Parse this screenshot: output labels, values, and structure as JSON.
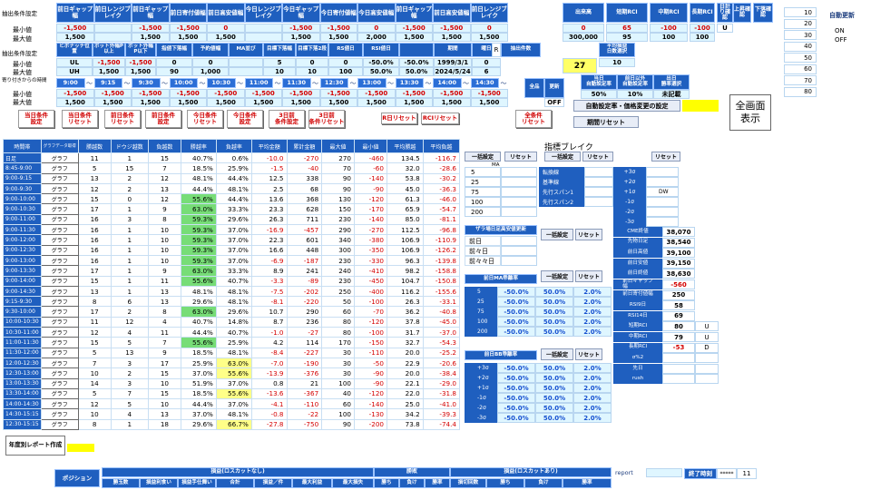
{
  "top": {
    "row1_label": "抽出条件設定",
    "row1_headers": [
      "前日ギャップ幅",
      "前日レンジブレイク",
      "前日ギャップ幅",
      "前日寄付値幅",
      "前日高安値幅",
      "今日レンジブレイク",
      "今日ギャップ幅",
      "今日寄付値幅",
      "今日高安値幅",
      "前日ギャップ幅",
      "前日高安値幅",
      "前日レンジブレイク"
    ],
    "min_label": "最小値",
    "max_label": "最大値",
    "row1_min": [
      "-1,500",
      "",
      "-1,500",
      "-1,500",
      "0",
      "",
      "-1,500",
      "-1,500",
      "0",
      "-1,500",
      "-1,500",
      "0"
    ],
    "row1_max": [
      "1,500",
      "",
      "1,500",
      "1,500",
      "1,500",
      "",
      "1,500",
      "1,500",
      "2,000",
      "1,500",
      "1,500",
      "1,500"
    ],
    "right1_headers": [
      "出来高",
      "短期RCI",
      "中期RCI",
      "長期RCI",
      "日計り確認",
      "上昇確認",
      "下落確認"
    ],
    "right1_min": [
      "0",
      "65",
      "-100",
      "-100"
    ],
    "right1_max": [
      "300,000",
      "95",
      "100",
      "100"
    ],
    "right1_u": "U",
    "side_col": [
      "10",
      "20",
      "30",
      "40",
      "50",
      "60",
      "70",
      "80"
    ],
    "auto_update_label": "自動更新",
    "on_label": "ON",
    "off_label": "OFF",
    "row2_label": "抽出条件設定",
    "row2_headers": [
      "ヒボナッチ位置",
      "ボット外幅P以上",
      "ボット外幅P以下",
      "指値下落幅",
      "予約値幅",
      "MA並び",
      "目標下落幅",
      "目標下落2段",
      "RS値日",
      "RSI値日",
      "",
      "期間",
      "曜日",
      "抽出件数"
    ],
    "row2_min": [
      "UL",
      "-1,500",
      "-1,500",
      "0",
      "0",
      "",
      "5",
      "0",
      "0",
      "-50.0%",
      "-50.0%",
      "1999/3/1",
      "0"
    ],
    "row2_max": [
      "UH",
      "1,500",
      "1,500",
      "90",
      "1,000",
      "",
      "10",
      "10",
      "100",
      "50.0%",
      "50.0%",
      "2024/5/24",
      "6"
    ],
    "row2_R": "R",
    "count_value": "27",
    "avg_label": "平均損益\n日数選択",
    "avg_value": "10",
    "row3_label": "寄り付きからの時間",
    "row3_values": [
      "9:00",
      "9:15",
      "9:30",
      "10:00",
      "10:30",
      "11:00",
      "11:30",
      "12:30",
      "13:00",
      "13:30",
      "14:00",
      "14:30"
    ],
    "row3_sep": "〜",
    "row4_min": [
      "-1,500",
      "-1,500",
      "-1,500",
      "-1,500",
      "-1,500",
      "-1,500",
      "-1,500",
      "-1,500",
      "-1,500",
      "-1,500",
      "-1,500",
      "-1,500"
    ],
    "row4_max": [
      "1,500",
      "1,500",
      "1,500",
      "1,500",
      "1,500",
      "1,500",
      "1,500",
      "1,500",
      "1,500",
      "1,500",
      "1,500",
      "1,500"
    ],
    "ud_labels": [
      "全品",
      "更新"
    ],
    "off_value": "OFF",
    "day_labels": [
      "当日\n自動設定率",
      "前日以外\n自動設定率",
      "出日\n勝率選択"
    ],
    "pct_vals": [
      "50%",
      "10%",
      "未記載"
    ]
  },
  "buttons": {
    "reset_row": [
      "当日条件\n設定",
      "当日条件\nリセット",
      "前日条件\nリセット",
      "前日条件\n設定",
      "今日条件\nリセット",
      "今日条件\n設定",
      "3日前\n条件設定",
      "3日前\n条件リセット"
    ],
    "r_reset": "R日リセット",
    "rci_reset": "RCIリセット",
    "all_reset": "全条件\nリセット",
    "auto_setting": "自動設定率・価格変更の設定",
    "period_reset": "期間リセット",
    "fullscreen": "全画面\n表示",
    "yearly_report": "年度別レポート作成"
  },
  "table": {
    "headers": [
      "時間帯",
      "グラフデータ取得",
      "勝越数",
      "ドウジ越数",
      "負越数",
      "勝越率",
      "負越率",
      "平均金額",
      "累計金額",
      "最大値",
      "最小値",
      "平均勝越",
      "平均負越"
    ],
    "graph_label": "グラフ",
    "rows": [
      [
        "日足",
        "11",
        "1",
        "15",
        "40.7%",
        "0.6%",
        "-10.0",
        "-270",
        "270",
        "-460",
        "134.5",
        "-116.7"
      ],
      [
        "8:45-9:00",
        "5",
        "15",
        "7",
        "18.5%",
        "25.9%",
        "-1.5",
        "-40",
        "70",
        "-60",
        "32.0",
        "-28.6"
      ],
      [
        "9:00-9:15",
        "13",
        "2",
        "12",
        "48.1%",
        "44.4%",
        "12.5",
        "338",
        "90",
        "-140",
        "53.8",
        "-30.2"
      ],
      [
        "9:00-9:30",
        "12",
        "2",
        "13",
        "44.4%",
        "48.1%",
        "2.5",
        "68",
        "90",
        "-90",
        "45.0",
        "-36.3"
      ],
      [
        "9:00-10:00",
        "15",
        "0",
        "12",
        "55.6%",
        "44.4%",
        "13.6",
        "368",
        "130",
        "-120",
        "61.3",
        "-46.0"
      ],
      [
        "9:00-10:30",
        "17",
        "1",
        "9",
        "63.0%",
        "33.3%",
        "23.3",
        "628",
        "150",
        "-170",
        "65.9",
        "-54.7"
      ],
      [
        "9:00-11:00",
        "16",
        "3",
        "8",
        "59.3%",
        "29.6%",
        "26.3",
        "711",
        "230",
        "-140",
        "85.0",
        "-81.1"
      ],
      [
        "9:00-11:30",
        "16",
        "1",
        "10",
        "59.3%",
        "37.0%",
        "-16.9",
        "-457",
        "290",
        "-270",
        "112.5",
        "-96.8"
      ],
      [
        "9:00-12:00",
        "16",
        "1",
        "10",
        "59.3%",
        "37.0%",
        "22.3",
        "601",
        "340",
        "-380",
        "106.9",
        "-110.9"
      ],
      [
        "9:00-12:30",
        "16",
        "1",
        "10",
        "59.3%",
        "37.0%",
        "16.6",
        "448",
        "300",
        "-350",
        "106.9",
        "-126.2"
      ],
      [
        "9:00-13:00",
        "16",
        "1",
        "10",
        "59.3%",
        "37.0%",
        "-6.9",
        "-187",
        "230",
        "-330",
        "96.3",
        "-139.8"
      ],
      [
        "9:00-13:30",
        "17",
        "1",
        "9",
        "63.0%",
        "33.3%",
        "8.9",
        "241",
        "240",
        "-410",
        "98.2",
        "-158.8"
      ],
      [
        "9:00-14:00",
        "15",
        "1",
        "11",
        "55.6%",
        "40.7%",
        "-3.3",
        "-89",
        "230",
        "-450",
        "104.7",
        "-150.8"
      ],
      [
        "9:00-14:30",
        "13",
        "1",
        "13",
        "48.1%",
        "48.1%",
        "-7.5",
        "-202",
        "250",
        "-400",
        "116.2",
        "-155.6"
      ],
      [
        "9:15-9:30",
        "8",
        "6",
        "13",
        "29.6%",
        "48.1%",
        "-8.1",
        "-220",
        "50",
        "-100",
        "26.3",
        "-33.1"
      ],
      [
        "9:30-10:00",
        "17",
        "2",
        "8",
        "63.0%",
        "29.6%",
        "10.7",
        "290",
        "60",
        "-70",
        "36.2",
        "-40.8"
      ],
      [
        "10:00-10:30",
        "11",
        "12",
        "4",
        "40.7%",
        "14.8%",
        "8.7",
        "236",
        "80",
        "-120",
        "37.8",
        "-45.0"
      ],
      [
        "10:30-11:00",
        "12",
        "4",
        "11",
        "44.4%",
        "40.7%",
        "-1.0",
        "-27",
        "80",
        "-100",
        "31.7",
        "-37.0"
      ],
      [
        "11:00-11:30",
        "15",
        "5",
        "7",
        "55.6%",
        "25.9%",
        "4.2",
        "114",
        "170",
        "-150",
        "32.7",
        "-54.3"
      ],
      [
        "11:30-12:00",
        "5",
        "13",
        "9",
        "18.5%",
        "48.1%",
        "-8.4",
        "-227",
        "30",
        "-110",
        "20.0",
        "-25.2"
      ],
      [
        "12:00-12:30",
        "7",
        "3",
        "17",
        "25.9%",
        "63.0%",
        "-7.0",
        "-190",
        "30",
        "-50",
        "22.9",
        "-20.6"
      ],
      [
        "12:30-13:00",
        "10",
        "2",
        "15",
        "37.0%",
        "55.6%",
        "-13.9",
        "-376",
        "30",
        "-90",
        "20.0",
        "-38.4"
      ],
      [
        "13:00-13:30",
        "14",
        "3",
        "10",
        "51.9%",
        "37.0%",
        "0.8",
        "21",
        "100",
        "-90",
        "22.1",
        "-29.0"
      ],
      [
        "13:30-14:00",
        "5",
        "7",
        "15",
        "18.5%",
        "55.6%",
        "-13.6",
        "-367",
        "40",
        "-120",
        "22.0",
        "-31.8"
      ],
      [
        "14:00-14:30",
        "12",
        "5",
        "10",
        "44.4%",
        "37.0%",
        "-4.1",
        "-110",
        "60",
        "-140",
        "25.0",
        "-41.0"
      ],
      [
        "14:30-15:15",
        "10",
        "4",
        "13",
        "37.0%",
        "48.1%",
        "-0.8",
        "-22",
        "100",
        "-130",
        "34.2",
        "-39.3"
      ],
      [
        "12:30-15:15",
        "8",
        "1",
        "18",
        "29.6%",
        "66.7%",
        "-27.8",
        "-750",
        "90",
        "-200",
        "73.8",
        "-74.4"
      ]
    ]
  },
  "break": {
    "title": "指標ブレイク",
    "ma_label": "MA",
    "hi_label": "日",
    "ma_btns": [
      "一括設定",
      "リセット",
      "一括設定",
      "リセット",
      "リセット"
    ],
    "ma_values": [
      "5",
      "25",
      "75",
      "100",
      "200"
    ],
    "ichimoku": [
      "転換線",
      "基準線",
      "先行スパン1",
      "先行スパン2"
    ],
    "bb": [
      "+3σ",
      "+2σ",
      "+1σ",
      "-1σ",
      "-2σ",
      "-3σ"
    ],
    "bb_right": "DW",
    "gap_title": "ザラ場日足高安値更新",
    "gap_rows": [
      "前日",
      "前々日",
      "前々々日"
    ],
    "gap_btns": [
      "一括設定",
      "リセット"
    ],
    "tbl_date": "2024/5/24(金)",
    "prev_rows": [
      [
        "CME終値",
        "38,070"
      ],
      [
        "先物日足",
        "38,540"
      ],
      [
        "前日高値",
        "39,100"
      ],
      [
        "前日安値",
        "39,150"
      ],
      [
        "前日終値",
        "38,630"
      ],
      [
        "前日ギャップ\n幅",
        "-560"
      ],
      [
        "前日寄付値幅",
        "250"
      ],
      [
        "RSI9日",
        "58"
      ],
      [
        "RSI14日",
        "69"
      ],
      [
        "短期RCI",
        "80",
        "U"
      ],
      [
        "中期RCI",
        "79",
        "U"
      ],
      [
        "長期RCI",
        "-53",
        "D"
      ],
      [
        "σ%2",
        "",
        ""
      ],
      [
        "先日",
        "",
        ""
      ],
      [
        "rush",
        "",
        ""
      ]
    ],
    "ma_rate_title": "前日MA乖離率",
    "ma_rate_btns": [
      "一括設定",
      "リセット"
    ],
    "ma_rate_rows": [
      [
        "5",
        "-50.0%",
        "50.0%",
        "2.0%"
      ],
      [
        "25",
        "-50.0%",
        "50.0%",
        "2.0%"
      ],
      [
        "75",
        "-50.0%",
        "50.0%",
        "2.0%"
      ],
      [
        "100",
        "-50.0%",
        "50.0%",
        "2.0%"
      ],
      [
        "200",
        "-50.0%",
        "50.0%",
        "2.0%"
      ]
    ],
    "bb_rate_title": "前日BB乖離率",
    "bb_rate_btns": [
      "一括設定",
      "リセット"
    ],
    "bb_rate_rows": [
      [
        "+3σ",
        "-50.0%",
        "50.0%",
        "2.0%"
      ],
      [
        "+2σ",
        "-50.0%",
        "50.0%",
        "2.0%"
      ],
      [
        "+1σ",
        "-50.0%",
        "50.0%",
        "2.0%"
      ],
      [
        "-1σ",
        "-50.0%",
        "50.0%",
        "2.0%"
      ],
      [
        "-2σ",
        "-50.0%",
        "50.0%",
        "2.0%"
      ],
      [
        "-3σ",
        "-50.0%",
        "50.0%",
        "2.0%"
      ]
    ]
  },
  "bottom": {
    "position_label": "ポジション",
    "group1": "損益(ロスカットなし)",
    "group2": "勝敗",
    "group3": "損益(ロスカットあり)",
    "report_label": "report",
    "end_time_label": "終了時刻",
    "end_time_value": "11",
    "pw": "*****",
    "subheaders": [
      "勝玉数",
      "損益利食い",
      "損益手仕舞い",
      "合計",
      "損益／件",
      "最大利益",
      "最大損失",
      "勝ち",
      "負け",
      "勝率",
      "損切回数",
      "勝ち",
      "負け",
      "勝率"
    ]
  }
}
